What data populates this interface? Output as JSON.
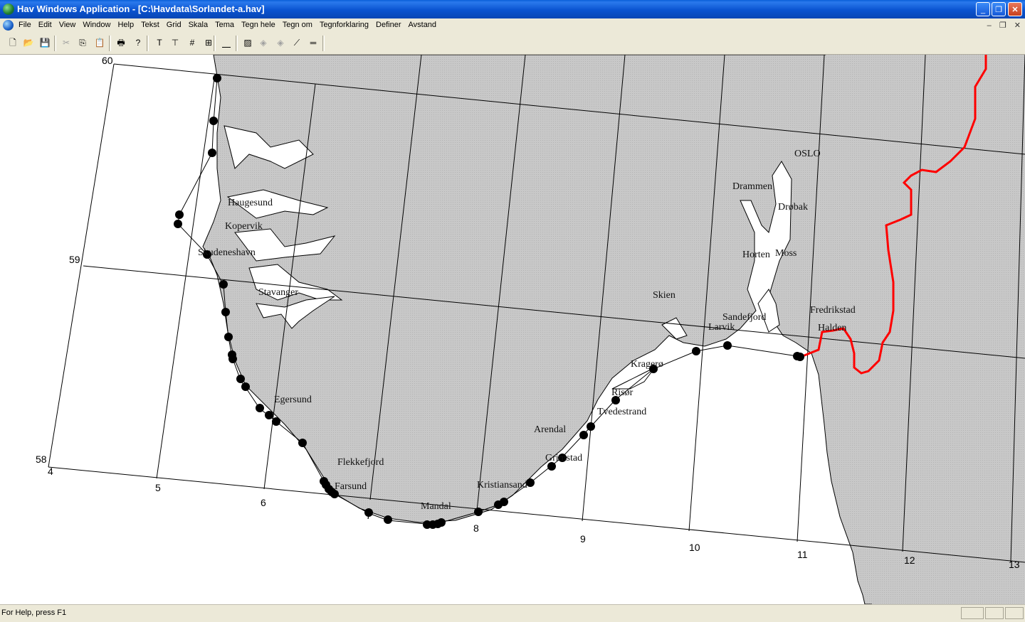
{
  "window": {
    "title": "Hav Windows Application - [C:\\Havdata\\Sorlandet-a.hav]",
    "minimize": "_",
    "restore": "❐",
    "close": "✕"
  },
  "menu": [
    "File",
    "Edit",
    "View",
    "Window",
    "Help",
    "Tekst",
    "Grid",
    "Skala",
    "Tema",
    "Tegn hele",
    "Tegn om",
    "Tegnforklaring",
    "Definer",
    "Avstand"
  ],
  "mdi": {
    "minimize": "–",
    "restore": "❐",
    "close": "✕"
  },
  "toolbar": [
    {
      "name": "new-icon",
      "glyph": "🗋",
      "enabled": true
    },
    {
      "name": "open-icon",
      "glyph": "📂",
      "enabled": true
    },
    {
      "name": "save-icon",
      "glyph": "💾",
      "enabled": true
    },
    {
      "name": "cut-icon",
      "glyph": "✂",
      "enabled": false
    },
    {
      "name": "copy-icon",
      "glyph": "⎘",
      "enabled": true
    },
    {
      "name": "paste-icon",
      "glyph": "📋",
      "enabled": false
    },
    {
      "name": "print-icon",
      "glyph": "🖶",
      "enabled": true
    },
    {
      "name": "help-icon",
      "glyph": "?",
      "enabled": true
    },
    {
      "name": "text-icon",
      "glyph": "T",
      "enabled": true
    },
    {
      "name": "text-anchor-icon",
      "glyph": "⊤",
      "enabled": true
    },
    {
      "name": "grid-icon",
      "glyph": "#",
      "enabled": true
    },
    {
      "name": "layout-icon",
      "glyph": "⊞",
      "enabled": true
    },
    {
      "name": "scale-icon",
      "glyph": "⎽",
      "enabled": true
    },
    {
      "name": "theme-icon",
      "glyph": "▨",
      "enabled": true
    },
    {
      "name": "draw-all-icon",
      "glyph": "◈",
      "enabled": false
    },
    {
      "name": "redraw-icon",
      "glyph": "◈",
      "enabled": false
    },
    {
      "name": "distance-icon",
      "glyph": "⟋",
      "enabled": true
    },
    {
      "name": "legend-icon",
      "glyph": "═",
      "enabled": true
    }
  ],
  "map": {
    "land_color": "#c8c8c8",
    "sea_color": "#ffffff",
    "border_color": "#ff0000",
    "grid_color": "#000000",
    "lat_labels": [
      "60",
      "59",
      "58"
    ],
    "lon_labels": [
      "4",
      "5",
      "6",
      "7",
      "8",
      "9",
      "10",
      "11",
      "12",
      "13"
    ],
    "places": [
      "OSLO",
      "Drammen",
      "Drøbak",
      "Haugesund",
      "Kopervik",
      "Skudeneshavn",
      "Horten",
      "Moss",
      "Stavanger",
      "Skien",
      "Sandefjord",
      "Larvik",
      "Fredrikstad",
      "Halden",
      "Kragerø",
      "Risør",
      "Egersund",
      "Tvedestrand",
      "Arendal",
      "Grimstad",
      "Flekkefjord",
      "Farsund",
      "Kristiansand",
      "Mandal"
    ]
  },
  "status": {
    "message": "For Help, press F1"
  }
}
